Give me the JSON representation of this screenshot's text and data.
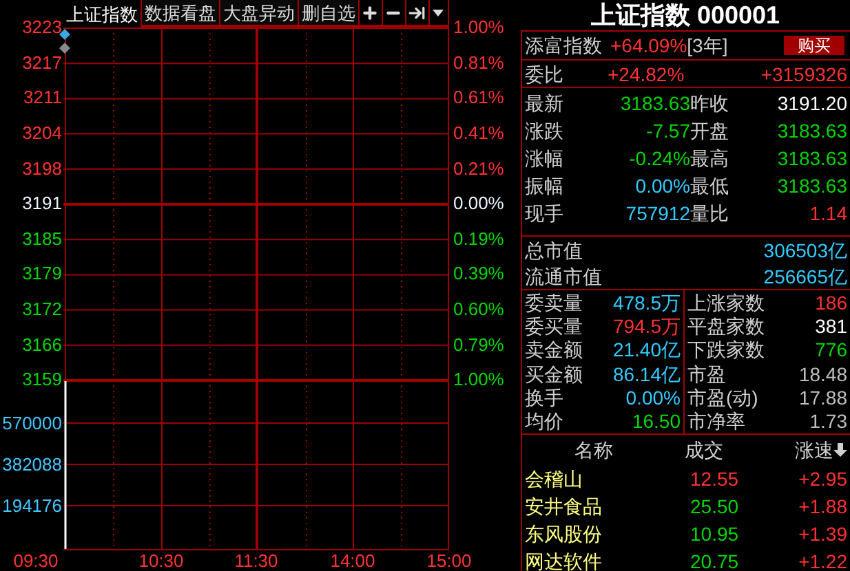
{
  "tabs": [
    {
      "label": "上证指数",
      "selected": true
    },
    {
      "label": "数据看盘",
      "selected": false
    },
    {
      "label": "大盘异动",
      "selected": false
    },
    {
      "label": "删自选",
      "selected": false
    }
  ],
  "chart": {
    "price_labels": [
      {
        "text": "3223",
        "color": "#ff3232"
      },
      {
        "text": "3217",
        "color": "#ff3232"
      },
      {
        "text": "3211",
        "color": "#ff3232"
      },
      {
        "text": "3204",
        "color": "#ff3232"
      },
      {
        "text": "3198",
        "color": "#ff3232"
      },
      {
        "text": "3191",
        "color": "#e8f4ff"
      },
      {
        "text": "3185",
        "color": "#00d800"
      },
      {
        "text": "3179",
        "color": "#00d800"
      },
      {
        "text": "3172",
        "color": "#00d800"
      },
      {
        "text": "3166",
        "color": "#00d800"
      },
      {
        "text": "3159",
        "color": "#00d800"
      }
    ],
    "percent_labels": [
      {
        "text": "1.00%",
        "color": "#ff3232"
      },
      {
        "text": "0.81%",
        "color": "#ff3232"
      },
      {
        "text": "0.61%",
        "color": "#ff3232"
      },
      {
        "text": "0.41%",
        "color": "#ff3232"
      },
      {
        "text": "0.21%",
        "color": "#ff3232"
      },
      {
        "text": "0.00%",
        "color": "#e8f4ff"
      },
      {
        "text": "0.19%",
        "color": "#00d800"
      },
      {
        "text": "0.39%",
        "color": "#00d800"
      },
      {
        "text": "0.60%",
        "color": "#00d800"
      },
      {
        "text": "0.79%",
        "color": "#00d800"
      },
      {
        "text": "1.00%",
        "color": "#00d800"
      }
    ],
    "volume_labels": [
      "570000",
      "382088",
      "194176"
    ],
    "time_labels": [
      "09:30",
      "10:30",
      "11:30",
      "14:00",
      "15:00"
    ]
  },
  "quote": {
    "title": "上证指数 000001",
    "fund": {
      "label": "添富指数",
      "change": "+64.09%",
      "period": "[3年]",
      "button": "购买"
    },
    "ratio": {
      "label": "委比",
      "percent": "+24.82%",
      "diff": "+3159326"
    },
    "stats": [
      {
        "left": {
          "label": "最新",
          "value": "3183.63",
          "color": "#00d800"
        },
        "right": {
          "label": "昨收",
          "value": "3191.20",
          "color": "#ffffff"
        }
      },
      {
        "left": {
          "label": "涨跌",
          "value": "-7.57",
          "color": "#00d800"
        },
        "right": {
          "label": "开盘",
          "value": "3183.63",
          "color": "#00d800"
        }
      },
      {
        "left": {
          "label": "涨幅",
          "value": "-0.24%",
          "color": "#00d800"
        },
        "right": {
          "label": "最高",
          "value": "3183.63",
          "color": "#00d800"
        }
      },
      {
        "left": {
          "label": "振幅",
          "value": "0.00%",
          "color": "#33ccff"
        },
        "right": {
          "label": "最低",
          "value": "3183.63",
          "color": "#00d800"
        }
      },
      {
        "left": {
          "label": "现手",
          "value": "757912",
          "color": "#33ccff"
        },
        "right": {
          "label": "量比",
          "value": "1.14",
          "color": "#ff3232"
        }
      }
    ],
    "market_cap": [
      {
        "label": "总市值",
        "value": "306503亿"
      },
      {
        "label": "流通市值",
        "value": "256665亿"
      }
    ],
    "orders": [
      {
        "left": {
          "label": "委卖量",
          "value": "478.5万",
          "color": "#33ccff"
        },
        "right": {
          "label": "上涨家数",
          "value": "186",
          "color": "#ff3232"
        }
      },
      {
        "left": {
          "label": "委买量",
          "value": "794.5万",
          "color": "#ff3232"
        },
        "right": {
          "label": "平盘家数",
          "value": "381",
          "color": "#ffffff"
        }
      },
      {
        "left": {
          "label": "卖金额",
          "value": "21.40亿",
          "color": "#33ccff"
        },
        "right": {
          "label": "下跌家数",
          "value": "776",
          "color": "#00d800"
        }
      },
      {
        "left": {
          "label": "买金额",
          "value": "86.14亿",
          "color": "#33ccff"
        },
        "right": {
          "label": "市盈",
          "value": "18.48",
          "color": "#c0c0c0"
        }
      },
      {
        "left": {
          "label": "换手",
          "value": "0.00%",
          "color": "#33ccff"
        },
        "right": {
          "label": "市盈(动)",
          "value": "17.88",
          "color": "#c0c0c0"
        }
      },
      {
        "left": {
          "label": "均价",
          "value": "16.50",
          "color": "#00d800"
        },
        "right": {
          "label": "市净率",
          "value": "1.73",
          "color": "#c0c0c0"
        }
      }
    ],
    "stock_columns": [
      "名称",
      "成交",
      "涨速"
    ],
    "stocks": [
      {
        "name": "会稽山",
        "price": {
          "text": "12.55",
          "color": "#ff3232"
        },
        "speed": {
          "text": "+2.95",
          "color": "#ff3232"
        }
      },
      {
        "name": "安井食品",
        "price": {
          "text": "25.50",
          "color": "#00d800"
        },
        "speed": {
          "text": "+1.88",
          "color": "#ff3232"
        }
      },
      {
        "name": "东风股份",
        "price": {
          "text": "10.95",
          "color": "#00d800"
        },
        "speed": {
          "text": "+1.39",
          "color": "#ff3232"
        }
      },
      {
        "name": "网达软件",
        "price": {
          "text": "20.75",
          "color": "#00d800"
        },
        "speed": {
          "text": "+1.22",
          "color": "#ff3232"
        }
      }
    ]
  }
}
